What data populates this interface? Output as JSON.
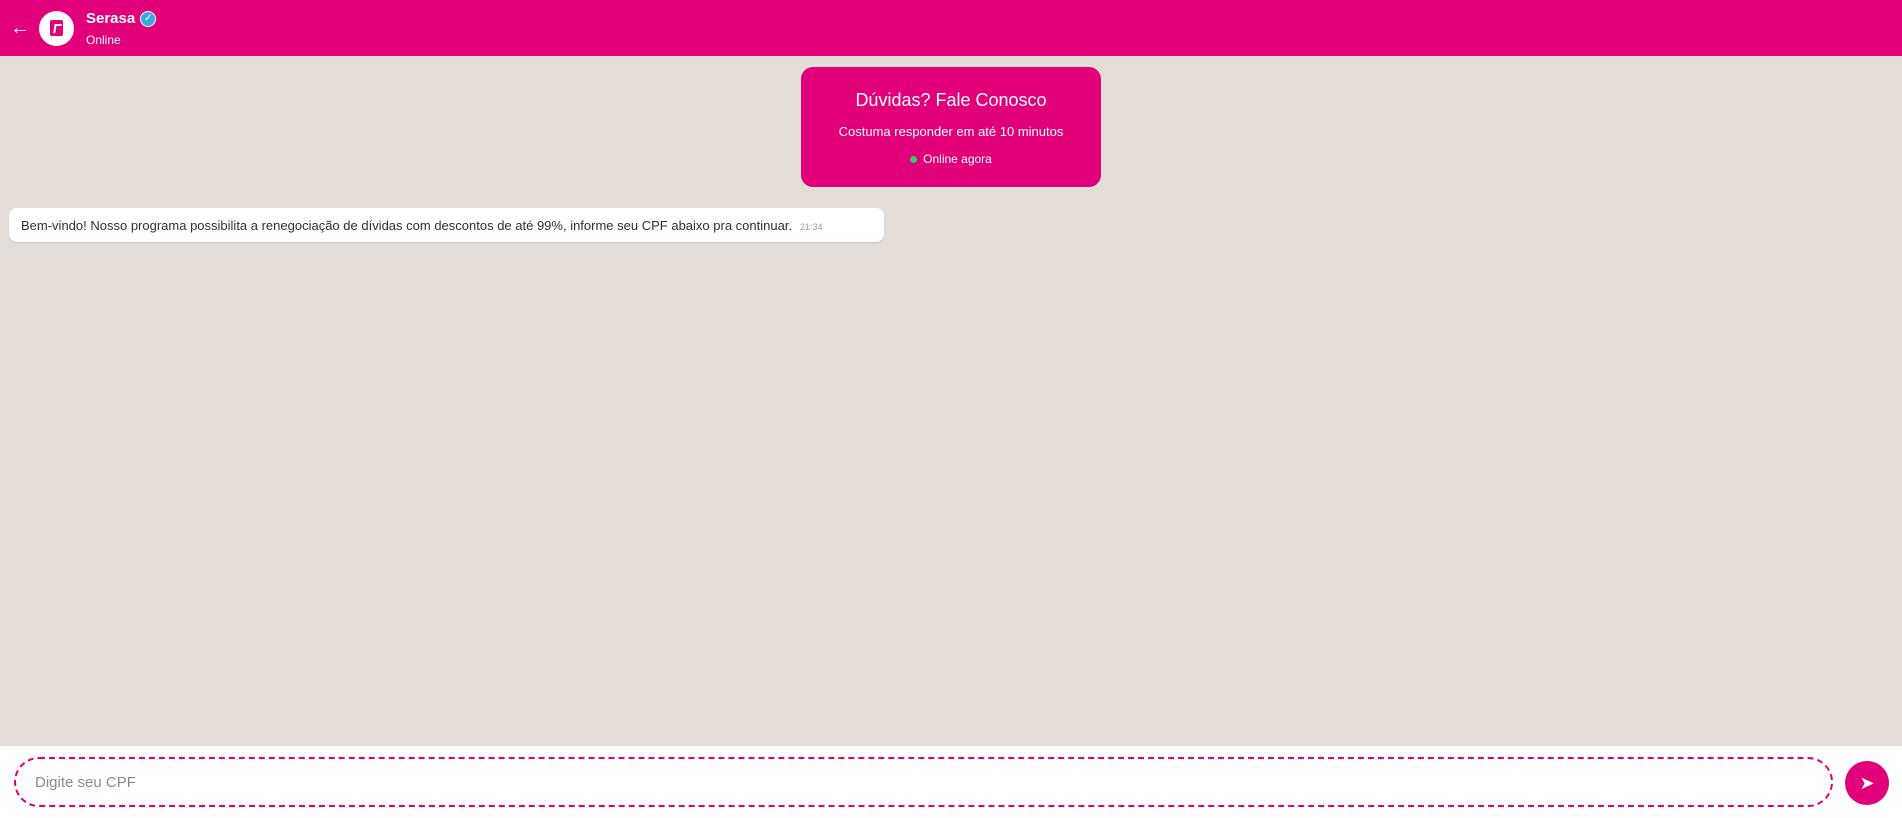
{
  "header": {
    "back_icon": "←",
    "avatar_icon": "serasa-logo-icon",
    "name": "Serasa",
    "verified_icon": "✓",
    "status": "Online"
  },
  "info_card": {
    "title": "Dúvidas? Fale Conosco",
    "subtitle": "Costuma responder em até 10 minutos",
    "online_text": "Online agora",
    "online_dot_color": "#2ecc71"
  },
  "messages": [
    {
      "text": "Bem-vindo! Nosso programa possibilita a renegociação de dívidas com descontos de até 99%, informe seu CPF abaixo pra continuar.",
      "time": "21:34"
    }
  ],
  "composer": {
    "placeholder": "Digite seu CPF",
    "value": "",
    "send_icon": "➤"
  },
  "colors": {
    "brand": "#e2007a",
    "chat_background": "#e5ddd7",
    "verified": "#39a9e6"
  }
}
